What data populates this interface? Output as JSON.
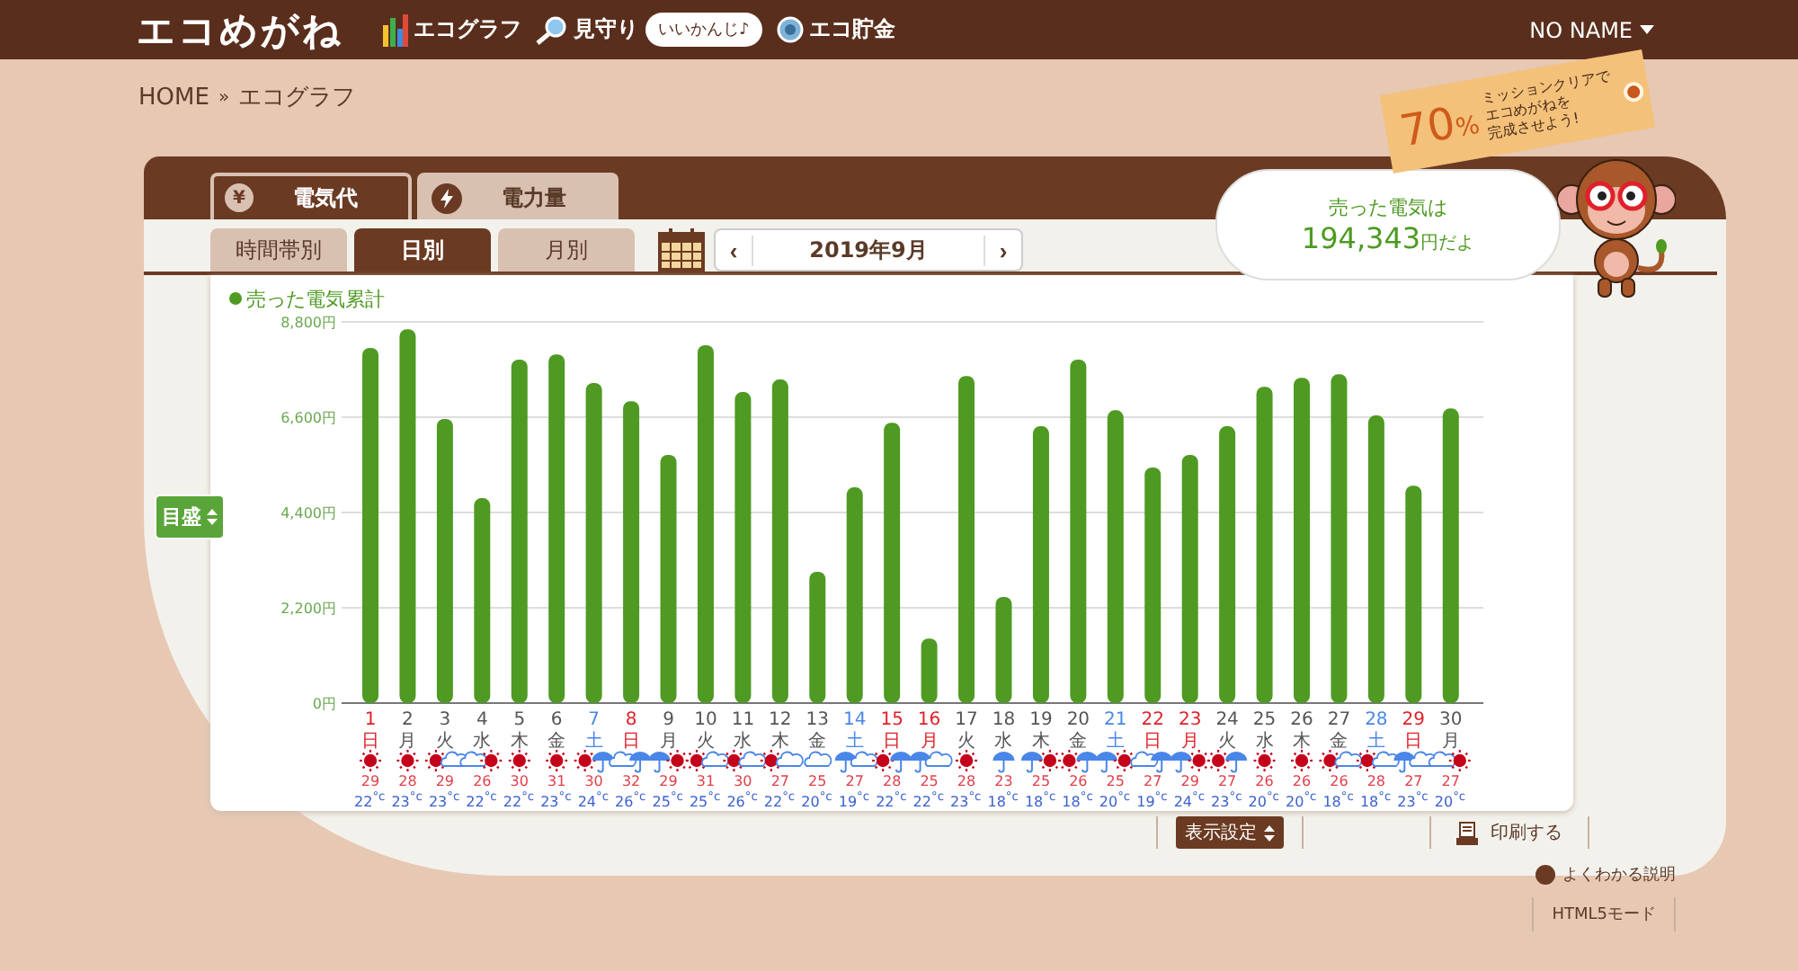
{
  "header": {
    "logo": "エコめがね",
    "nav": [
      {
        "label": "エコグラフ",
        "kind": "bars"
      },
      {
        "label": "見守り",
        "kind": "magnifier"
      },
      {
        "label": "エコ貯金",
        "kind": "coin"
      }
    ],
    "badge": "いいかんじ♪",
    "user": "NO NAME"
  },
  "breadcrumb": [
    "HOME",
    "»",
    "エコグラフ"
  ],
  "mission_tag": {
    "percent": "70",
    "percent_unit": "%",
    "lines": [
      "ミッションクリアで",
      "エコめがねを",
      "完成させよう!"
    ]
  },
  "tabs": [
    {
      "label": "電気代",
      "kind": "yen",
      "icon_glyph": "¥",
      "selected": true
    },
    {
      "label": "電力量",
      "kind": "bolt",
      "selected": false
    }
  ],
  "period_tabs": [
    {
      "label": "時間帯別",
      "selected": false
    },
    {
      "label": "日別",
      "selected": true
    },
    {
      "label": "月別",
      "selected": false
    }
  ],
  "month_nav": {
    "prev": "‹",
    "label": "2019年9月",
    "next": "›"
  },
  "bubble": {
    "line": "売った電気は",
    "amount": "194,343",
    "unit": "円だよ"
  },
  "scale_button": "目盛",
  "chart": {
    "chart_data": {
      "type": "bar",
      "grid": true,
      "categories": [
        "1",
        "2",
        "3",
        "4",
        "5",
        "6",
        "7",
        "8",
        "9",
        "10",
        "11",
        "12",
        "13",
        "14",
        "15",
        "16",
        "17",
        "18",
        "19",
        "20",
        "21",
        "22",
        "23",
        "24",
        "25",
        "26",
        "27",
        "28",
        "29",
        "30"
      ],
      "series": [
        {
          "name": "売った電気累計",
          "color": "#4e9a22",
          "values": [
            8200,
            8630,
            6560,
            4730,
            7930,
            8050,
            7390,
            6970,
            5730,
            8260,
            7180,
            7470,
            3030,
            4980,
            6470,
            1490,
            7550,
            2450,
            6390,
            7930,
            6760,
            5440,
            5730,
            6390,
            7300,
            7510,
            7590,
            6640,
            5020,
            6800
          ]
        }
      ],
      "ylim": [
        0,
        8800
      ],
      "yticks": [
        {
          "value": 0,
          "label": "0円"
        },
        {
          "value": 2200,
          "label": "2,200円"
        },
        {
          "value": 4400,
          "label": "4,400円"
        },
        {
          "value": 6600,
          "label": "6,600円"
        },
        {
          "value": 8800,
          "label": "8,800円"
        }
      ]
    },
    "days": [
      {
        "weekday": "日",
        "kind": "holiday",
        "weather": [
          {
            "kind": "sun"
          }
        ],
        "high": "29",
        "low": "22$^{°c}$"
      },
      {
        "weekday": "月",
        "kind": "weekday",
        "weather": [
          {
            "kind": "sun"
          }
        ],
        "high": "28",
        "low": "23$^{°c}$"
      },
      {
        "weekday": "火",
        "kind": "weekday",
        "weather": [
          {
            "kind": "sun"
          },
          {
            "kind": "cloud"
          }
        ],
        "high": "29",
        "low": "23$^{°c}$"
      },
      {
        "weekday": "水",
        "kind": "weekday",
        "weather": [
          {
            "kind": "cloud"
          },
          {
            "kind": "sun"
          }
        ],
        "high": "26",
        "low": "22$^{°c}$"
      },
      {
        "weekday": "木",
        "kind": "weekday",
        "weather": [
          {
            "kind": "sun"
          }
        ],
        "high": "30",
        "low": "22$^{°c}$"
      },
      {
        "weekday": "金",
        "kind": "weekday",
        "weather": [
          {
            "kind": "sun"
          }
        ],
        "high": "31",
        "low": "23$^{°c}$"
      },
      {
        "weekday": "土",
        "kind": "saturday",
        "weather": [
          {
            "kind": "sun"
          },
          {
            "kind": "rain"
          }
        ],
        "high": "30",
        "low": "24$^{°c}$"
      },
      {
        "weekday": "日",
        "kind": "holiday",
        "weather": [
          {
            "kind": "cloud"
          },
          {
            "kind": "rain"
          }
        ],
        "high": "32",
        "low": "26$^{°c}$"
      },
      {
        "weekday": "月",
        "kind": "weekday",
        "weather": [
          {
            "kind": "rain"
          },
          {
            "kind": "sun"
          }
        ],
        "high": "29",
        "low": "25$^{°c}$"
      },
      {
        "weekday": "火",
        "kind": "weekday",
        "weather": [
          {
            "kind": "sun"
          },
          {
            "kind": "cloud"
          }
        ],
        "high": "31",
        "low": "25$^{°c}$"
      },
      {
        "weekday": "水",
        "kind": "weekday",
        "weather": [
          {
            "kind": "sun"
          },
          {
            "kind": "cloud"
          }
        ],
        "high": "30",
        "low": "26$^{°c}$"
      },
      {
        "weekday": "木",
        "kind": "weekday",
        "weather": [
          {
            "kind": "sun"
          },
          {
            "kind": "cloud"
          }
        ],
        "high": "27",
        "low": "22$^{°c}$"
      },
      {
        "weekday": "金",
        "kind": "weekday",
        "weather": [
          {
            "kind": "cloud"
          }
        ],
        "high": "25",
        "low": "20$^{°c}$"
      },
      {
        "weekday": "土",
        "kind": "saturday",
        "weather": [
          {
            "kind": "rain"
          },
          {
            "kind": "cloud"
          }
        ],
        "high": "27",
        "low": "19$^{°c}$"
      },
      {
        "weekday": "日",
        "kind": "holiday",
        "weather": [
          {
            "kind": "sun"
          },
          {
            "kind": "rain"
          }
        ],
        "high": "28",
        "low": "22$^{°c}$"
      },
      {
        "weekday": "月",
        "kind": "holiday",
        "weather": [
          {
            "kind": "rain"
          },
          {
            "kind": "cloud"
          }
        ],
        "high": "25",
        "low": "22$^{°c}$"
      },
      {
        "weekday": "火",
        "kind": "weekday",
        "weather": [
          {
            "kind": "sun"
          }
        ],
        "high": "28",
        "low": "23$^{°c}$"
      },
      {
        "weekday": "水",
        "kind": "weekday",
        "weather": [
          {
            "kind": "rain"
          }
        ],
        "high": "23",
        "low": "18$^{°c}$"
      },
      {
        "weekday": "木",
        "kind": "weekday",
        "weather": [
          {
            "kind": "rain"
          },
          {
            "kind": "sun"
          }
        ],
        "high": "25",
        "low": "18$^{°c}$"
      },
      {
        "weekday": "金",
        "kind": "weekday",
        "weather": [
          {
            "kind": "sun"
          },
          {
            "kind": "rain"
          }
        ],
        "high": "26",
        "low": "18$^{°c}$"
      },
      {
        "weekday": "土",
        "kind": "saturday",
        "weather": [
          {
            "kind": "rain"
          },
          {
            "kind": "sun"
          }
        ],
        "high": "25",
        "low": "20$^{°c}$"
      },
      {
        "weekday": "日",
        "kind": "holiday",
        "weather": [
          {
            "kind": "cloud"
          },
          {
            "kind": "rain"
          }
        ],
        "high": "27",
        "low": "19$^{°c}$"
      },
      {
        "weekday": "月",
        "kind": "holiday",
        "weather": [
          {
            "kind": "rain"
          },
          {
            "kind": "sun"
          }
        ],
        "high": "29",
        "low": "24$^{°c}$"
      },
      {
        "weekday": "火",
        "kind": "weekday",
        "weather": [
          {
            "kind": "sun"
          },
          {
            "kind": "rain"
          }
        ],
        "high": "27",
        "low": "23$^{°c}$"
      },
      {
        "weekday": "水",
        "kind": "weekday",
        "weather": [
          {
            "kind": "sun"
          }
        ],
        "high": "26",
        "low": "20$^{°c}$"
      },
      {
        "weekday": "木",
        "kind": "weekday",
        "weather": [
          {
            "kind": "sun"
          }
        ],
        "high": "26",
        "low": "20$^{°c}$"
      },
      {
        "weekday": "金",
        "kind": "weekday",
        "weather": [
          {
            "kind": "sun"
          },
          {
            "kind": "cloud"
          }
        ],
        "high": "26",
        "low": "18$^{°c}$"
      },
      {
        "weekday": "土",
        "kind": "saturday",
        "weather": [
          {
            "kind": "sun"
          },
          {
            "kind": "cloud"
          }
        ],
        "high": "28",
        "low": "18$^{°c}$"
      },
      {
        "weekday": "日",
        "kind": "holiday",
        "weather": [
          {
            "kind": "rain"
          },
          {
            "kind": "cloud"
          }
        ],
        "high": "27",
        "low": "23$^{°c}$"
      },
      {
        "weekday": "月",
        "kind": "weekday",
        "weather": [
          {
            "kind": "cloud"
          },
          {
            "kind": "sun"
          }
        ],
        "high": "27",
        "low": "20$^{°c}$"
      }
    ]
  },
  "display_settings": "表示設定",
  "print": "印刷する",
  "help": "よくわかる説明",
  "html5_mode": "HTML5モード"
}
